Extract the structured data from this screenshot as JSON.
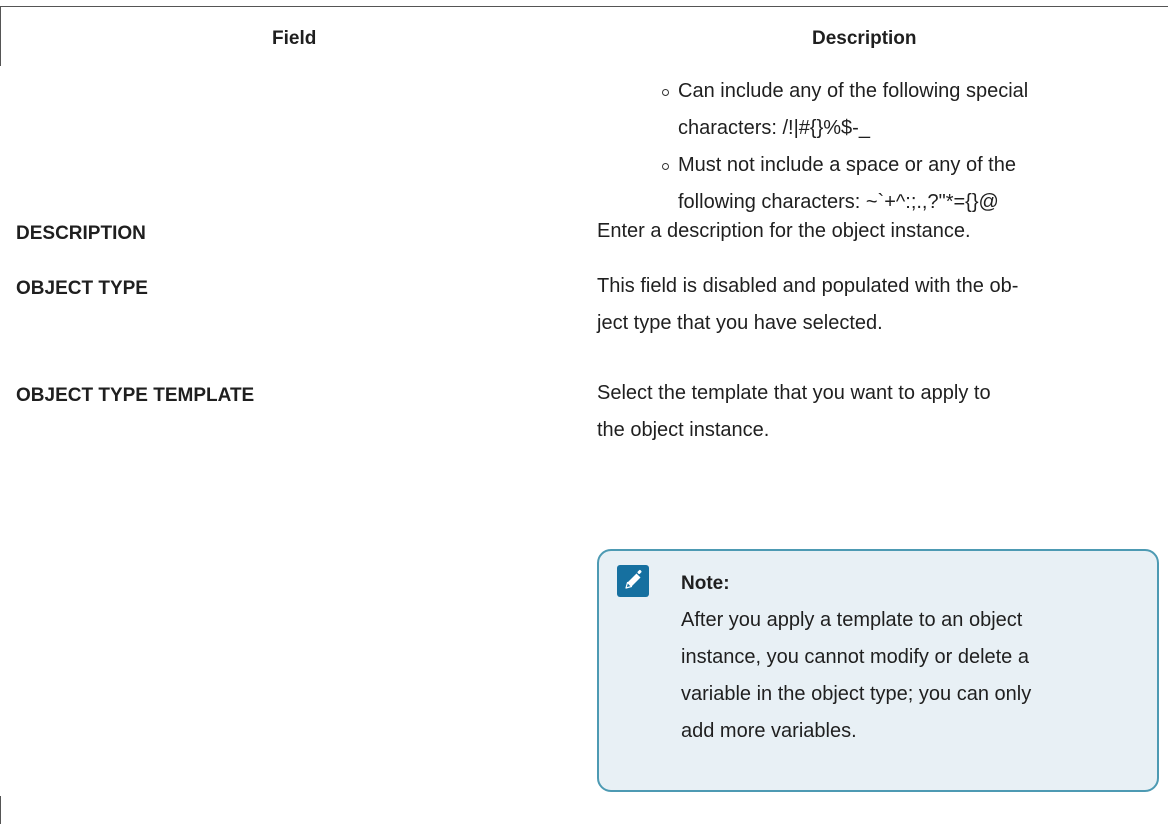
{
  "table": {
    "headers": {
      "field": "Field",
      "description": "Description"
    },
    "continued_bullets": [
      {
        "lines": [
          "Can include any of the following special",
          "characters: /!|#{}%$-_"
        ]
      },
      {
        "lines": [
          "Must not include a space or any of the",
          "following characters: ~`+^:;.,?\"*={}@"
        ]
      }
    ],
    "rows": [
      {
        "field": "DESCRIPTION",
        "lines": [
          "Enter a description for the object instance."
        ]
      },
      {
        "field": "OBJECT TYPE",
        "lines": [
          "This field is disabled and populated with the ob-",
          "ject type that you have selected."
        ]
      },
      {
        "field": "OBJECT TYPE TEMPLATE",
        "lines": [
          "Select the template that you want to apply to",
          "the object instance."
        ]
      }
    ],
    "note": {
      "icon": "pencil-icon",
      "title": "Note:",
      "lines": [
        "After you apply a template to an object",
        "instance, you cannot modify or delete a",
        "variable in the object type; you can only",
        "add more variables."
      ]
    }
  },
  "colors": {
    "note_border": "#4d9ab3",
    "note_background": "#e8f0f5",
    "note_icon": "#1670a0"
  }
}
